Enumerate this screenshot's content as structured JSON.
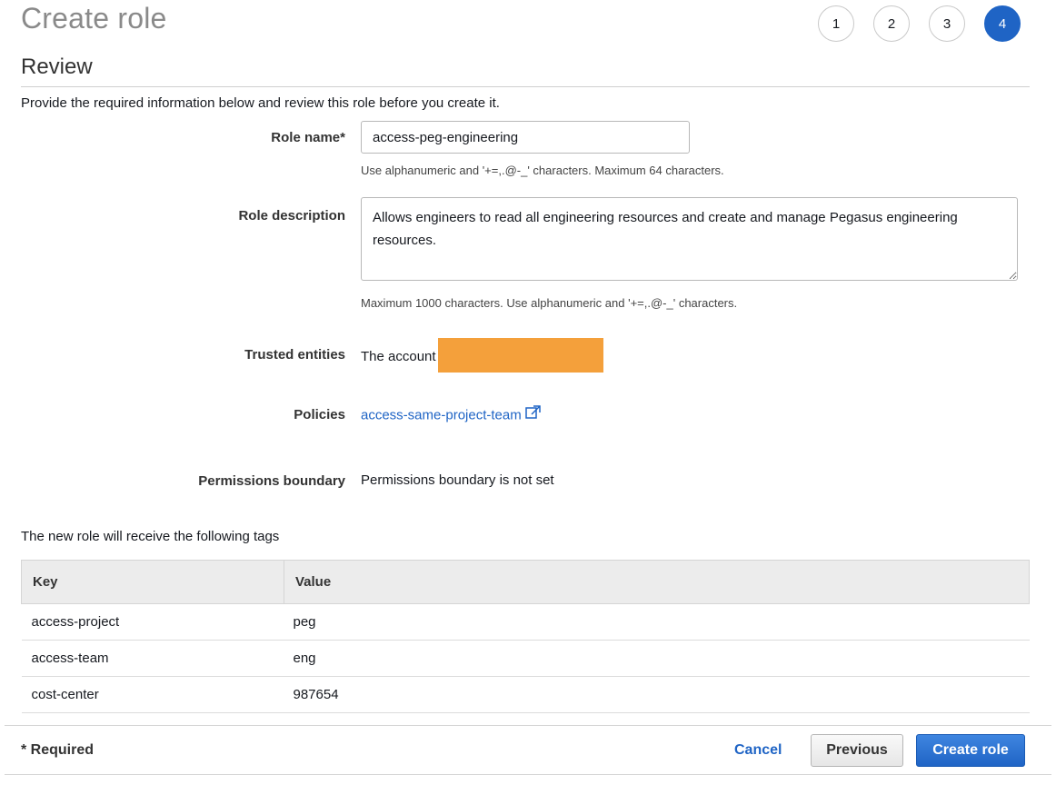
{
  "header": {
    "title": "Create role",
    "steps": [
      "1",
      "2",
      "3",
      "4"
    ],
    "active_step": "4"
  },
  "review": {
    "section_title": "Review",
    "intro": "Provide the required information below and review this role before you create it."
  },
  "form": {
    "role_name_label": "Role name*",
    "role_name_value": "access-peg-engineering",
    "role_name_hint": "Use alphanumeric and '+=,.@-_' characters. Maximum 64 characters.",
    "role_description_label": "Role description",
    "role_description_value": "Allows engineers to read all engineering resources and create and manage Pegasus engineering resources.",
    "role_description_hint": "Maximum 1000 characters. Use alphanumeric and '+=,.@-_' characters.",
    "trusted_entities_label": "Trusted entities",
    "trusted_entities_value": "The account",
    "policies_label": "Policies",
    "policy_link": "access-same-project-team",
    "permissions_boundary_label": "Permissions boundary",
    "permissions_boundary_value": "Permissions boundary is not set"
  },
  "tags": {
    "caption": "The new role will receive the following tags",
    "columns": [
      "Key",
      "Value"
    ],
    "rows": [
      {
        "key": "access-project",
        "value": "peg"
      },
      {
        "key": "access-team",
        "value": "eng"
      },
      {
        "key": "cost-center",
        "value": "987654"
      }
    ]
  },
  "footer": {
    "required_note": "* Required",
    "cancel_label": "Cancel",
    "previous_label": "Previous",
    "create_label": "Create role"
  },
  "colors": {
    "accent": "#1f64c5",
    "redaction": "#f4a03b"
  }
}
